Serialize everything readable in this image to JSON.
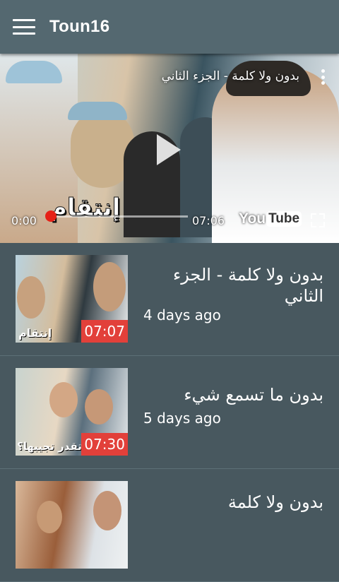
{
  "appbar": {
    "title": "Toun16"
  },
  "player": {
    "title": "بدون ولا كلمة - الجزء الثاني",
    "overlay_text": "إنتقام",
    "current_time": "0:00",
    "duration": "07:06",
    "yt_logo_you": "You",
    "yt_logo_tube": "Tube",
    "progress": 0
  },
  "videos": [
    {
      "title": "بدون ولا كلمة - الجزء الثاني",
      "age": "4 days ago",
      "duration": "07:07",
      "thumb_caption": "إنتقام"
    },
    {
      "title": "بدون ما تسمع شيء",
      "age": "5 days ago",
      "duration": "07:30",
      "thumb_caption": "تقدر تجيبها؟"
    },
    {
      "title": "بدون ولا كلمة",
      "age": "",
      "duration": "",
      "thumb_caption": ""
    }
  ],
  "colors": {
    "appbar": "#546870",
    "background": "#48585f",
    "accent": "#e62117",
    "duration_badge": "#e2403a"
  },
  "icons": [
    "menu-icon",
    "more-vert-icon",
    "play-icon",
    "fullscreen-icon",
    "youtube-logo"
  ]
}
